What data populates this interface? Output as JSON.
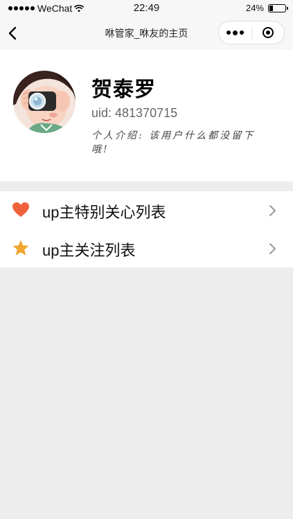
{
  "status_bar": {
    "carrier": "WeChat",
    "time": "22:49",
    "battery_percent": "24%",
    "battery_level": 0.24,
    "icons": [
      "signal-dots-icon",
      "wifi-icon",
      "battery-icon"
    ]
  },
  "nav": {
    "title": "咻管家_咻友的主页",
    "icons": [
      "back-arrow-icon",
      "more-dots-icon",
      "close-target-icon"
    ]
  },
  "profile": {
    "name": "贺泰罗",
    "uid": "uid: 481370715",
    "intro": "个人介绍: 该用户什么都没留下哦!"
  },
  "menu": {
    "items": [
      {
        "label": "up主特别关心列表",
        "icon": "heart-icon",
        "icon_color": "#f0623c"
      },
      {
        "label": "up主关注列表",
        "icon": "star-icon",
        "icon_color": "#f0a630"
      }
    ]
  },
  "colors": {
    "page_background": "#ededed",
    "card_background": "#ffffff",
    "heart": "#f0623c",
    "star": "#f0a630"
  }
}
